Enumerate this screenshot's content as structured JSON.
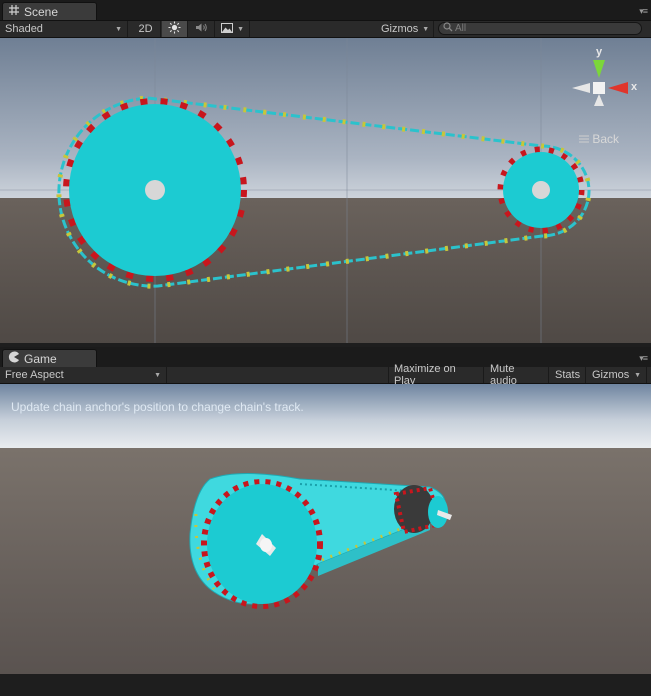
{
  "scene_panel": {
    "tab_label": "Scene",
    "tab_icon": "grid-icon",
    "toolbar": {
      "shading_mode": "Shaded",
      "mode_2d": "2D",
      "gizmos_label": "Gizmos",
      "search_placeholder": "All"
    },
    "axis_gizmo": {
      "y_label": "y",
      "x_label": "x",
      "back_label": "Back"
    }
  },
  "game_panel": {
    "tab_label": "Game",
    "tab_icon": "pacman-icon",
    "toolbar": {
      "aspect": "Free Aspect",
      "maximize_on_play": "Maximize on Play",
      "mute_audio": "Mute audio",
      "stats": "Stats",
      "gizmos_label": "Gizmos"
    },
    "hint_text": "Update chain anchor's position to change chain's track."
  },
  "colors": {
    "gear": "#1ccbd2",
    "hub": "#d7d7d7",
    "tooth": "#c8161d",
    "link_yellow": "#c7c63a",
    "sky": "#9aa7b7",
    "ground": "#5e5752",
    "gizmo_green": "#7cd63a",
    "gizmo_red": "#e0352b"
  }
}
